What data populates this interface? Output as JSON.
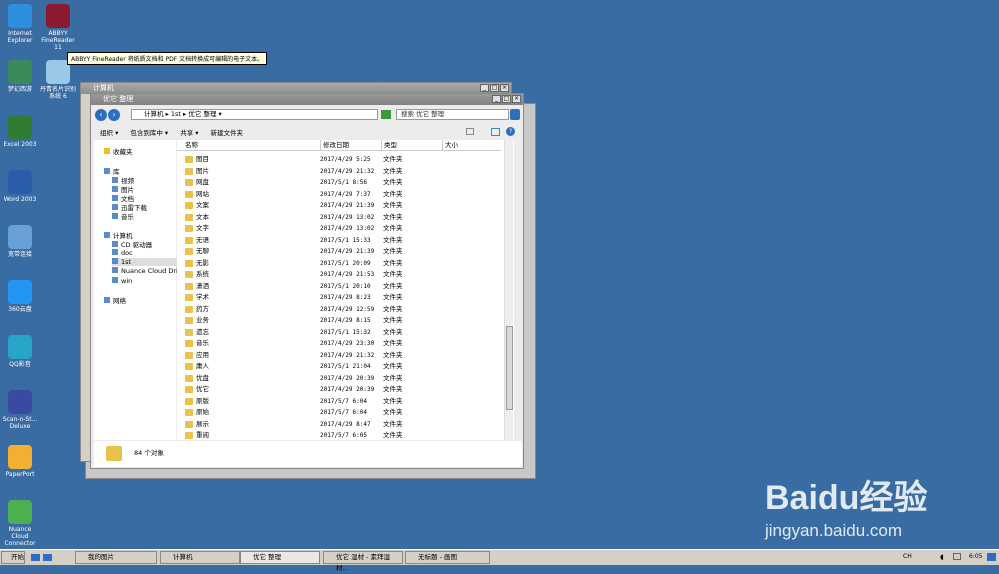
{
  "desktop": {
    "icons": [
      "Internet Explorer",
      "ABBYY FineReader 11",
      "梦幻西游",
      "丹青名片识别系统 6",
      "Excel 2003",
      "Word 2003",
      "宽带连接",
      "360云盘",
      "QQ影音",
      "Scan-n-St... Deluxe",
      "PaperPort",
      "Nuance Cloud Connector"
    ],
    "tooltip": "ABBYY FineReader 将纸质文档和 PDF 文档转换成可编辑的电子文本。"
  },
  "back_window": {
    "title": "计算机"
  },
  "explorer": {
    "title": "优它 整理",
    "breadcrumb": [
      "计算机",
      "1st",
      "优它 整理"
    ],
    "search_placeholder": "搜索 优它 整理",
    "commands": [
      "组织 ▾",
      "包含到库中 ▾",
      "共享 ▾",
      "新建文件夹"
    ],
    "columns": [
      "名称",
      "修改日期",
      "类型",
      "大小"
    ],
    "sidebar": [
      "收藏夹",
      "库",
      "视频",
      "图片",
      "文档",
      "迅雷下载",
      "音乐",
      "计算机",
      "CD 驱动器",
      "doc",
      "1st",
      "Nuance Cloud Drive",
      "win",
      "网络"
    ],
    "files": [
      [
        "图目",
        "2017/4/29 5:25"
      ],
      [
        "图片",
        "2017/4/29 21:32"
      ],
      [
        "网盘",
        "2017/5/1 8:56"
      ],
      [
        "网站",
        "2017/4/29 7:37"
      ],
      [
        "文案",
        "2017/4/29 21:39"
      ],
      [
        "文本",
        "2017/4/29 13:02"
      ],
      [
        "文字",
        "2017/4/29 13:02"
      ],
      [
        "无语",
        "2017/5/1 15:33"
      ],
      [
        "无聊",
        "2017/4/29 21:39"
      ],
      [
        "无影",
        "2017/5/1 20:09"
      ],
      [
        "系统",
        "2017/4/29 21:53"
      ],
      [
        "潇洒",
        "2017/5/1 20:10"
      ],
      [
        "学术",
        "2017/4/29 8:23"
      ],
      [
        "药方",
        "2017/4/29 12:59"
      ],
      [
        "业务",
        "2017/4/29 8:15"
      ],
      [
        "遗忘",
        "2017/5/1 15:32"
      ],
      [
        "音乐",
        "2017/4/29 23:30"
      ],
      [
        "应用",
        "2017/4/29 21:32"
      ],
      [
        "庸人",
        "2017/5/1 21:04"
      ],
      [
        "优盘",
        "2017/4/29 20:39"
      ],
      [
        "优它",
        "2017/4/29 20:39"
      ],
      [
        "原版",
        "2017/5/7 6:04"
      ],
      [
        "原始",
        "2017/5/7 6:04"
      ],
      [
        "展示",
        "2017/4/29 8:47"
      ],
      [
        "重阅",
        "2017/5/7 6:05"
      ]
    ],
    "file_type": "文件夹",
    "status": "84 个对象"
  },
  "taskbar": {
    "start": "开始",
    "items": [
      "我的图片",
      "计算机",
      "优它 整理",
      "优它 湿材 - 素拜湿材...",
      "无标题 - 画图"
    ],
    "lang": "CH",
    "time": "6:05"
  },
  "watermark": {
    "brand": "Baidu经验",
    "url": "jingyan.baidu.com"
  }
}
